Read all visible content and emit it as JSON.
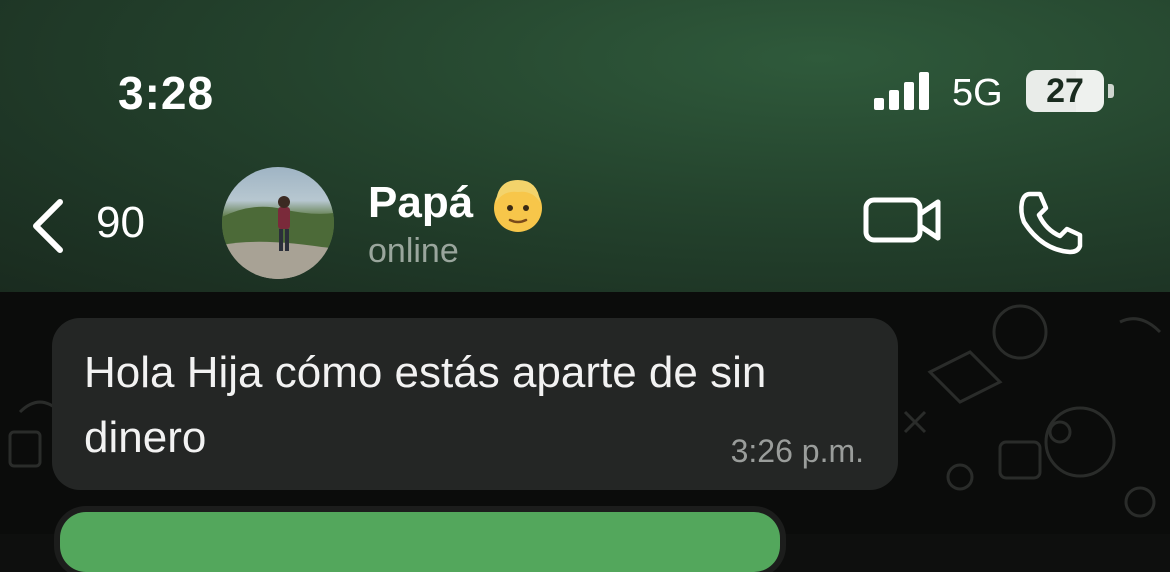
{
  "status_bar": {
    "time": "3:28",
    "network": "5G",
    "battery": "27",
    "icons": [
      "signal-icon",
      "battery-icon"
    ]
  },
  "header": {
    "back_count": "90",
    "contact_name": "Papá",
    "contact_emoji": "man-blond-emoji",
    "contact_status": "online",
    "icons": [
      "back-chevron-icon",
      "video-camera-icon",
      "phone-icon"
    ]
  },
  "messages": [
    {
      "text": "Hola Hija cómo estás aparte de sin dinero",
      "time": "3:26 p.m.",
      "direction": "incoming"
    }
  ],
  "colors": {
    "header_green": "#24432d",
    "bubble_incoming": "#242625",
    "bubble_outgoing": "#53a75c",
    "muted_text": "#9aa69d"
  }
}
